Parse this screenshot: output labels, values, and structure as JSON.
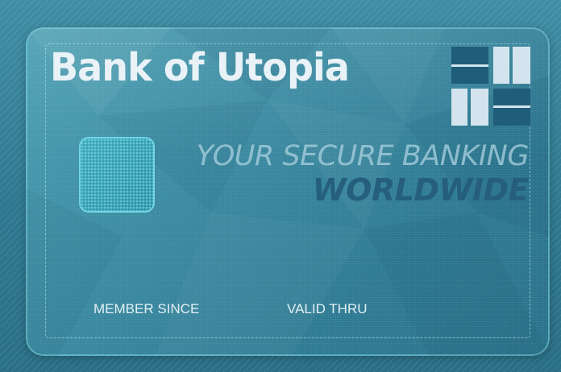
{
  "card": {
    "bank_name": "Bank of Utopia",
    "tagline_line1": "YOUR SECURE BANKING",
    "tagline_line2": "WORLDWIDE",
    "member_since_label": "MEMBER SINCE",
    "valid_thru_label": "VALID THRU",
    "logo_icon": "bank-block-logo-icon",
    "chip_icon": "card-chip-icon"
  },
  "colors": {
    "background": "#3f8ea4",
    "card_fill": "#3a8aa1",
    "bank_name_text": "#e9f2f6",
    "tagline_light": "#a5cddc",
    "tagline_dark": "#255f7b",
    "logo_light": "#d3e4ee",
    "logo_dark": "#1f5d7a",
    "chip_border": "#78dceb"
  }
}
